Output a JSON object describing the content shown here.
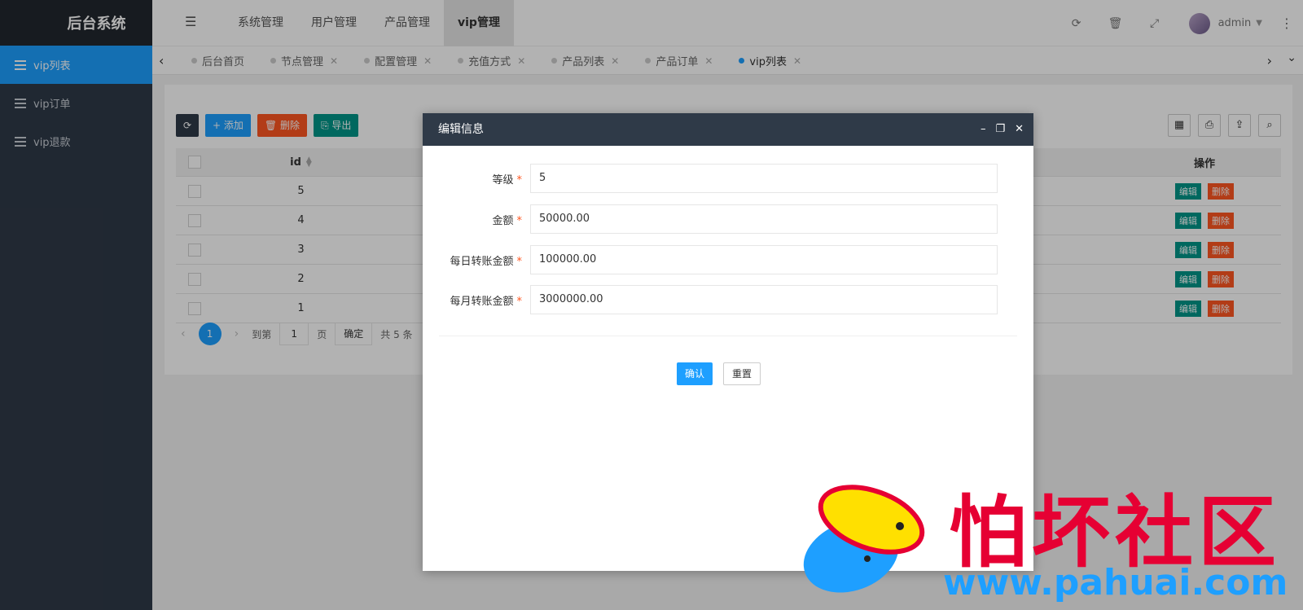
{
  "app": {
    "title": "后台系统"
  },
  "sidebar": {
    "items": [
      {
        "label": "vip列表",
        "active": true
      },
      {
        "label": "vip订单",
        "active": false
      },
      {
        "label": "vip退款",
        "active": false
      }
    ]
  },
  "header": {
    "nav": [
      {
        "label": "系统管理"
      },
      {
        "label": "用户管理"
      },
      {
        "label": "产品管理"
      },
      {
        "label": "vip管理",
        "active": true
      }
    ],
    "user": "admin",
    "icons": [
      "refresh-icon",
      "trash-icon",
      "fullscreen-icon",
      "more-icon"
    ]
  },
  "tabs": [
    {
      "label": "后台首页"
    },
    {
      "label": "节点管理"
    },
    {
      "label": "配置管理"
    },
    {
      "label": "充值方式"
    },
    {
      "label": "产品列表"
    },
    {
      "label": "产品订单"
    },
    {
      "label": "vip列表",
      "active": true
    }
  ],
  "toolbar": {
    "add": "添加",
    "delete": "删除",
    "export": "导出"
  },
  "table": {
    "headers": {
      "id": "id",
      "operation": "操作"
    },
    "rows": [
      {
        "id": "5"
      },
      {
        "id": "4"
      },
      {
        "id": "3"
      },
      {
        "id": "2"
      },
      {
        "id": "1"
      }
    ],
    "edit_label": "编辑",
    "delete_label": "删除"
  },
  "pager": {
    "current": "1",
    "goto_label": "到第",
    "page_input": "1",
    "page_label": "页",
    "ok_label": "确定",
    "total": "共 5 条"
  },
  "modal": {
    "title": "编辑信息",
    "fields": [
      {
        "label": "等级",
        "value": "5"
      },
      {
        "label": "金额",
        "value": "50000.00"
      },
      {
        "label": "每日转账金额",
        "value": "100000.00"
      },
      {
        "label": "每月转账金额",
        "value": "3000000.00"
      }
    ],
    "required_mark": "*",
    "confirm": "确认",
    "reset": "重置"
  },
  "watermark": {
    "text": "怕坏社区",
    "url": "www.pahuai.com"
  },
  "colors": {
    "accent": "#1e9fff",
    "sidebar": "#2f3a48",
    "danger": "#ff5722",
    "success": "#009688"
  }
}
